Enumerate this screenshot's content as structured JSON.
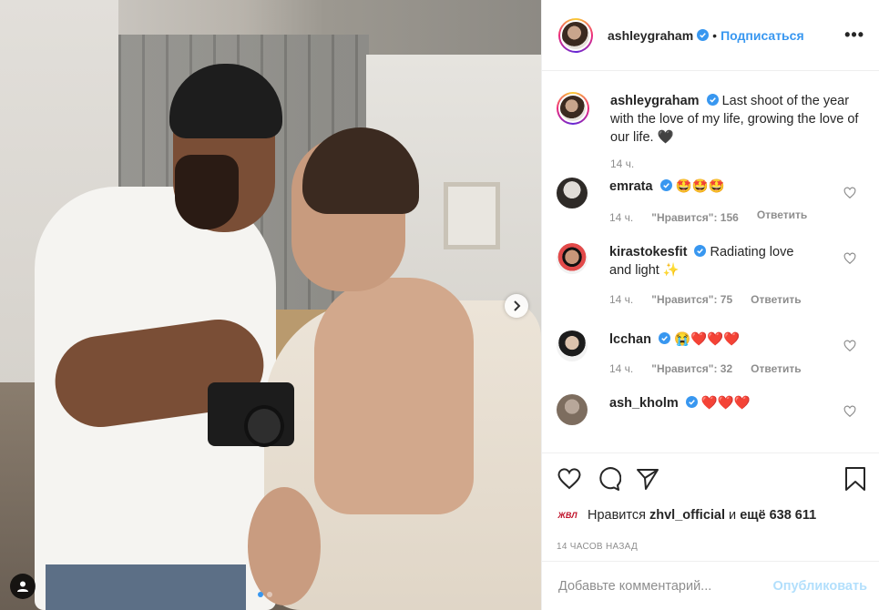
{
  "post": {
    "username": "ashleygraham",
    "follow_label": "Подписаться",
    "dot": "•",
    "more_label": "•••",
    "caption": "Last shoot of the year with the love of my life, growing the love of our life. 🖤",
    "caption_time": "14 ч.",
    "carousel": {
      "count": 2,
      "active": 0,
      "next_icon": "chevron-right-icon"
    }
  },
  "comments": [
    {
      "user": "emrata",
      "text": "🤩🤩🤩",
      "time": "14 ч.",
      "likes": "\"Нравится\": 156",
      "reply": "Ответить"
    },
    {
      "user": "kirastokesfit",
      "text": "Radiating love and light ✨",
      "time": "14 ч.",
      "likes": "\"Нравится\": 75",
      "reply": "Ответить"
    },
    {
      "user": "lcchan",
      "text": "😭❤️❤️❤️",
      "time": "14 ч.",
      "likes": "\"Нравится\": 32",
      "reply": "Ответить"
    },
    {
      "user": "ash_kholm",
      "text": "❤️❤️❤️",
      "time": "",
      "likes": "",
      "reply": ""
    }
  ],
  "actions": {
    "like_icon": "heart-icon",
    "comment_icon": "comment-icon",
    "share_icon": "paper-plane-icon",
    "save_icon": "bookmark-icon"
  },
  "likes": {
    "liker_badge": "ЖВЛ",
    "prefix": "Нравится",
    "liker": "zhvl_official",
    "middle": "и",
    "others": "ещё 638 611"
  },
  "timeago": "14 ЧАСОВ НАЗАД",
  "comment_box": {
    "placeholder": "Добавьте комментарий...",
    "post_label": "Опубликовать"
  },
  "colors": {
    "accent": "#3897f0",
    "post_disabled": "#b2dffc",
    "muted": "#8e8e8e"
  }
}
